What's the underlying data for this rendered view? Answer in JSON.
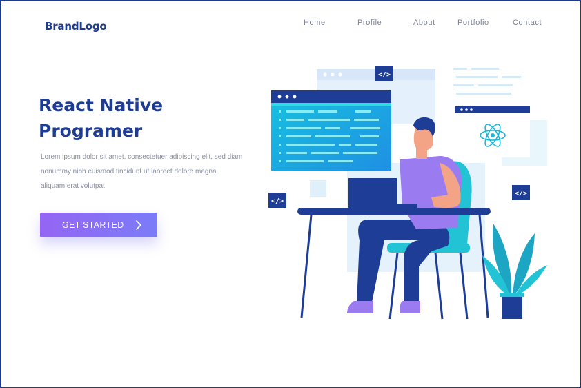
{
  "brand": {
    "logo_text": "BrandLogo"
  },
  "nav": {
    "items": [
      {
        "label": "Home"
      },
      {
        "label": "Profile"
      },
      {
        "label": "About"
      },
      {
        "label": "Portfolio"
      },
      {
        "label": "Contact"
      }
    ]
  },
  "hero": {
    "title_lines": [
      "React Native",
      "Programer"
    ],
    "description_lines": [
      "Lorem ipsum dolor sit amet, consectetuer adipiscing elit, sed diam",
      "nonummy nibh euismod tincidunt ut laoreet dolore magna",
      "aliquam erat volutpat"
    ],
    "cta": {
      "label": "GET STARTED",
      "icon": "chevron-right-icon"
    }
  },
  "illustration": {
    "code_badge_text": "</>",
    "colors": {
      "navy": "#1d3d96",
      "teal": "#16b8d6",
      "purple": "#9b7cf0",
      "light_blue": "#e2f1fb",
      "plant": "#1da6c4"
    }
  }
}
